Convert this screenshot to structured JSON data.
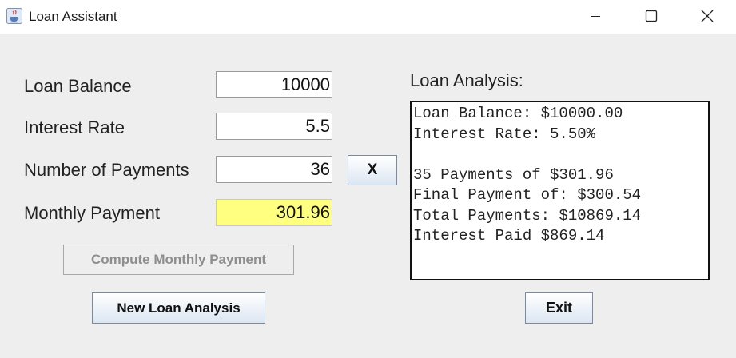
{
  "window": {
    "title": "Loan Assistant",
    "icon": "java-coffee-cup-icon",
    "controls": [
      "minimize-icon",
      "maximize-icon",
      "close-icon"
    ]
  },
  "form": {
    "loan_balance": {
      "label": "Loan Balance",
      "value": "10000"
    },
    "interest_rate": {
      "label": "Interest Rate",
      "value": "5.5"
    },
    "num_payments": {
      "label": "Number of Payments",
      "value": "36",
      "clear_button": "X"
    },
    "monthly_payment": {
      "label": "Monthly Payment",
      "value": "301.96",
      "highlight_color": "#ffff80"
    }
  },
  "buttons": {
    "compute": "Compute Monthly Payment",
    "new_analysis": "New Loan Analysis",
    "exit": "Exit"
  },
  "analysis": {
    "title": "Loan Analysis:",
    "lines": [
      "Loan Balance: $10000.00",
      "Interest Rate: 5.50%",
      "",
      "35 Payments of $301.96",
      "Final Payment of: $300.54",
      "Total Payments: $10869.14",
      "Interest Paid $869.14"
    ]
  }
}
